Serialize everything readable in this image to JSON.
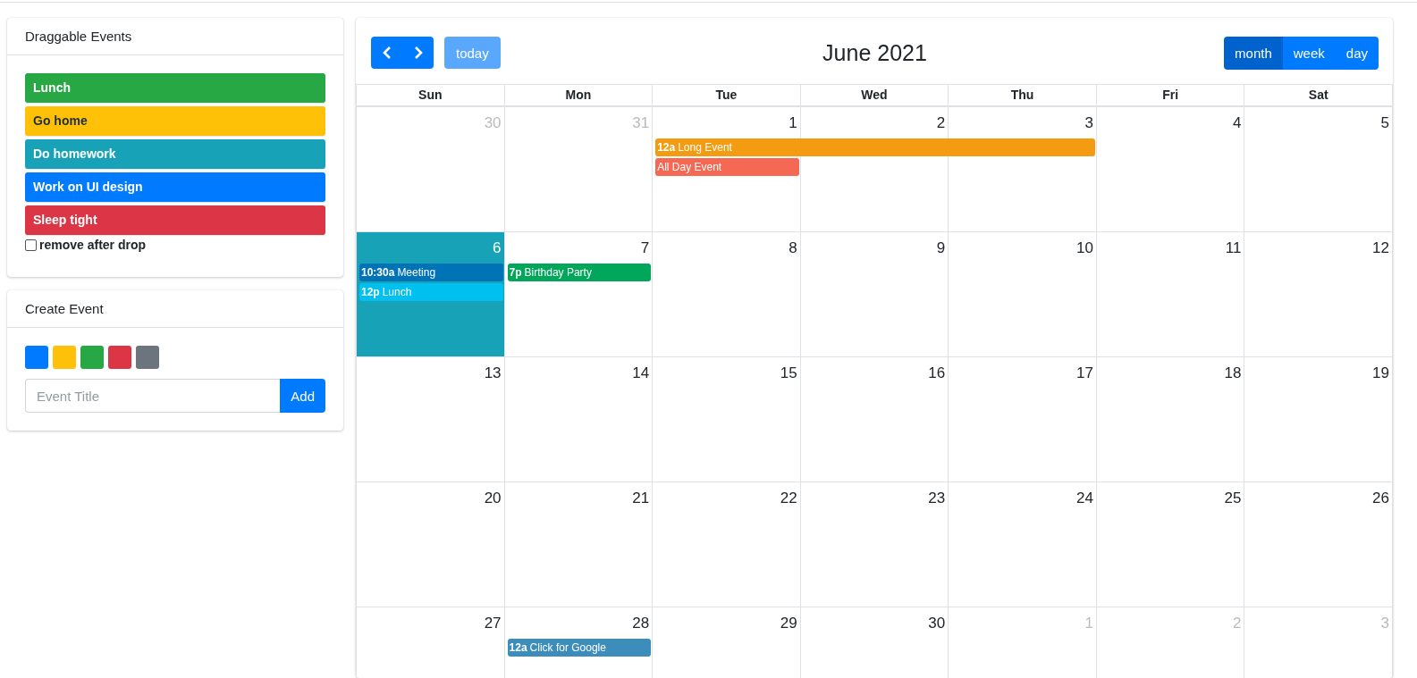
{
  "draggable_events": {
    "title": "Draggable Events",
    "items": [
      {
        "label": "Lunch",
        "color": "#28a745"
      },
      {
        "label": "Go home",
        "color": "#ffc107"
      },
      {
        "label": "Do homework",
        "color": "#17a2b8"
      },
      {
        "label": "Work on UI design",
        "color": "#007bff"
      },
      {
        "label": "Sleep tight",
        "color": "#dc3545"
      }
    ],
    "remove_after_drop": {
      "label": "remove after drop",
      "checked": false
    }
  },
  "create_event": {
    "title": "Create Event",
    "swatches": [
      {
        "color": "#007bff",
        "selected": false
      },
      {
        "color": "#ffc107",
        "selected": false
      },
      {
        "color": "#28a745",
        "selected": false
      },
      {
        "color": "#dc3545",
        "selected": false
      },
      {
        "color": "#6c757d",
        "selected": false
      }
    ],
    "input": {
      "placeholder": "Event Title"
    },
    "add_button": "Add"
  },
  "calendar": {
    "title": "June 2021",
    "today_button": {
      "label": "today",
      "disabled": true
    },
    "views": [
      {
        "label": "month",
        "selected": true
      },
      {
        "label": "week",
        "selected": false
      },
      {
        "label": "day",
        "selected": false
      }
    ],
    "weekdays": [
      "Sun",
      "Mon",
      "Tue",
      "Wed",
      "Thu",
      "Fri",
      "Sat"
    ],
    "weeks": [
      {
        "days": [
          {
            "date": "30",
            "other_month": true,
            "today": false
          },
          {
            "date": "31",
            "other_month": true,
            "today": false
          },
          {
            "date": "1",
            "other_month": false,
            "today": false,
            "events": [
              {
                "kind": "start",
                "time": "12a",
                "title": "Long Event",
                "color": "#f39c12"
              },
              {
                "kind": "start",
                "title": "All Day Event",
                "color": "#f56954"
              }
            ]
          },
          {
            "date": "2",
            "other_month": false,
            "today": false,
            "events": [
              {
                "kind": "continuation"
              }
            ]
          },
          {
            "date": "3",
            "other_month": false,
            "today": false,
            "events": [
              {
                "kind": "continuation"
              }
            ]
          },
          {
            "date": "4",
            "other_month": false,
            "today": false
          },
          {
            "date": "5",
            "other_month": false,
            "today": false
          }
        ]
      },
      {
        "days": [
          {
            "date": "6",
            "other_month": false,
            "today": true,
            "events": [
              {
                "kind": "start",
                "time": "10:30a",
                "title": "Meeting",
                "color": "#0073b7"
              },
              {
                "kind": "start",
                "time": "12p",
                "title": "Lunch",
                "color": "#00c0ef"
              }
            ]
          },
          {
            "date": "7",
            "other_month": false,
            "today": false,
            "events": [
              {
                "kind": "start",
                "time": "7p",
                "title": "Birthday Party",
                "color": "#00a65a"
              }
            ]
          },
          {
            "date": "8",
            "other_month": false,
            "today": false
          },
          {
            "date": "9",
            "other_month": false,
            "today": false
          },
          {
            "date": "10",
            "other_month": false,
            "today": false
          },
          {
            "date": "11",
            "other_month": false,
            "today": false
          },
          {
            "date": "12",
            "other_month": false,
            "today": false
          }
        ]
      },
      {
        "days": [
          {
            "date": "13",
            "other_month": false,
            "today": false
          },
          {
            "date": "14",
            "other_month": false,
            "today": false
          },
          {
            "date": "15",
            "other_month": false,
            "today": false
          },
          {
            "date": "16",
            "other_month": false,
            "today": false
          },
          {
            "date": "17",
            "other_month": false,
            "today": false
          },
          {
            "date": "18",
            "other_month": false,
            "today": false
          },
          {
            "date": "19",
            "other_month": false,
            "today": false
          }
        ]
      },
      {
        "days": [
          {
            "date": "20",
            "other_month": false,
            "today": false
          },
          {
            "date": "21",
            "other_month": false,
            "today": false
          },
          {
            "date": "22",
            "other_month": false,
            "today": false
          },
          {
            "date": "23",
            "other_month": false,
            "today": false
          },
          {
            "date": "24",
            "other_month": false,
            "today": false
          },
          {
            "date": "25",
            "other_month": false,
            "today": false
          },
          {
            "date": "26",
            "other_month": false,
            "today": false
          }
        ]
      },
      {
        "days": [
          {
            "date": "27",
            "other_month": false,
            "today": false
          },
          {
            "date": "28",
            "other_month": false,
            "today": false,
            "events": [
              {
                "kind": "start",
                "time": "12a",
                "title": "Click for Google",
                "color": "#3c8dbc"
              }
            ]
          },
          {
            "date": "29",
            "other_month": false,
            "today": false
          },
          {
            "date": "30",
            "other_month": false,
            "today": false
          },
          {
            "date": "1",
            "other_month": true,
            "today": false
          },
          {
            "date": "2",
            "other_month": true,
            "today": false
          },
          {
            "date": "3",
            "other_month": true,
            "today": false
          }
        ]
      }
    ]
  }
}
